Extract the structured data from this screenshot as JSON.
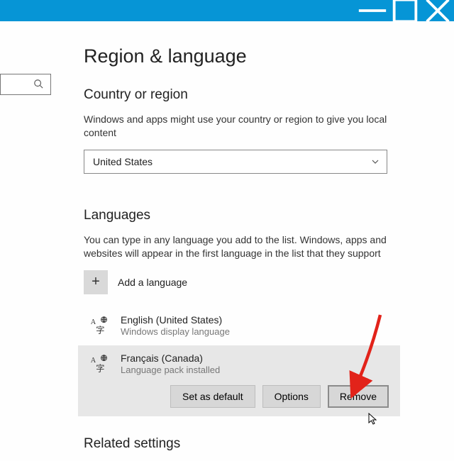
{
  "header": {
    "title": "Region & language"
  },
  "region": {
    "heading": "Country or region",
    "description": "Windows and apps might use your country or region to give you local content",
    "selected": "United States"
  },
  "languages": {
    "heading": "Languages",
    "description": "You can type in any language you add to the list. Windows, apps and websites will appear in the first language in the list that they support",
    "add_label": "Add a language",
    "items": [
      {
        "name": "English (United States)",
        "status": "Windows display language"
      },
      {
        "name": "Français (Canada)",
        "status": "Language pack installed"
      }
    ],
    "actions": {
      "set_default": "Set as default",
      "options": "Options",
      "remove": "Remove"
    }
  },
  "related": {
    "heading": "Related settings"
  }
}
